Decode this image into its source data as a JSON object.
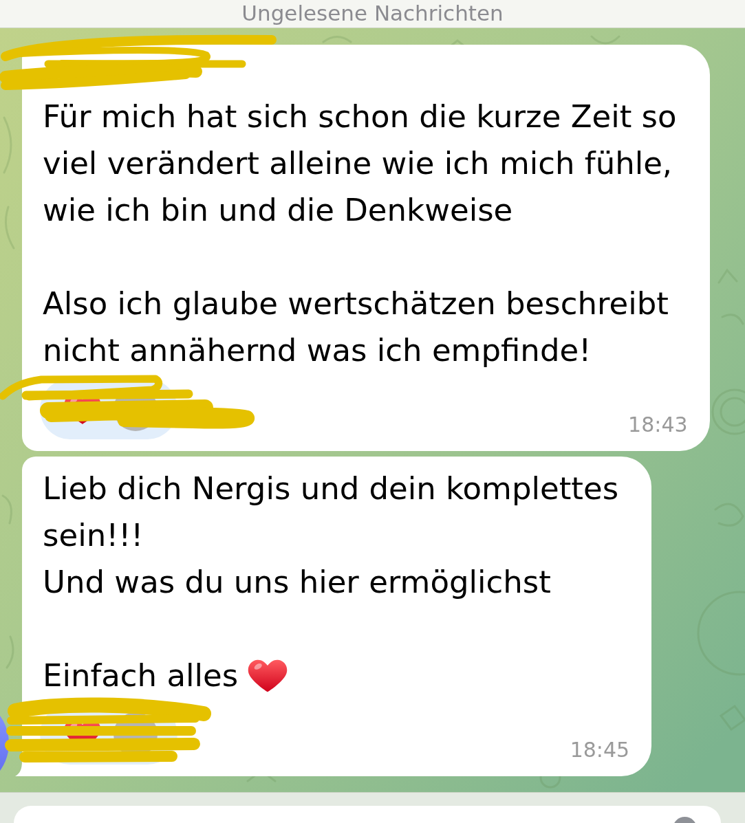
{
  "header": {
    "label": "Ungelesene Nachrichten"
  },
  "messages": [
    {
      "name_redacted": true,
      "paragraphs": [
        {
          "text": "Für mich hat sich schon die kurze Zeit so\nviel verändert alleine wie ich mich fühle,\nwie ich bin und die Denkweise",
          "heart": false
        },
        {
          "text": "Also ich glaube wertschätzen beschreibt\nnicht annähernd was ich empfinde!",
          "heart": false
        }
      ],
      "reaction": true,
      "time": "18:43",
      "tail": false,
      "avatar": false
    },
    {
      "name_redacted": false,
      "paragraphs": [
        {
          "text": "Lieb dich Nergis und dein komplettes\nsein!!!\nUnd was du uns hier ermöglichst",
          "heart": false
        },
        {
          "text": "Einfach alles",
          "heart": true
        }
      ],
      "reaction": true,
      "time": "18:45",
      "tail": true,
      "avatar": true
    }
  ]
}
